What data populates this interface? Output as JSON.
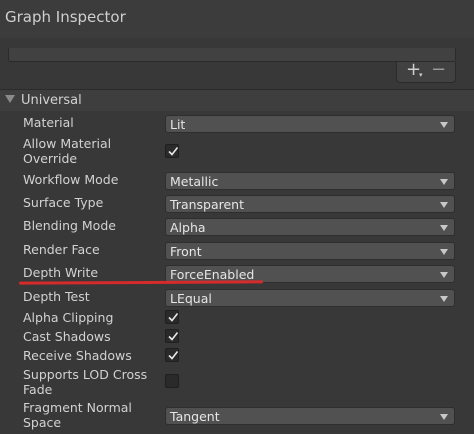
{
  "window": {
    "title": "Graph Inspector"
  },
  "list_controls": {
    "add_label": "+",
    "remove_label": "−"
  },
  "section": {
    "label": "Universal"
  },
  "properties": {
    "material": {
      "label": "Material",
      "value": "Lit"
    },
    "allow_override": {
      "label": "Allow Material Override",
      "checked": true
    },
    "workflow_mode": {
      "label": "Workflow Mode",
      "value": "Metallic"
    },
    "surface_type": {
      "label": "Surface Type",
      "value": "Transparent"
    },
    "blending_mode": {
      "label": "Blending Mode",
      "value": "Alpha"
    },
    "render_face": {
      "label": "Render Face",
      "value": "Front"
    },
    "depth_write": {
      "label": "Depth Write",
      "value": "ForceEnabled"
    },
    "depth_test": {
      "label": "Depth Test",
      "value": "LEqual"
    },
    "alpha_clipping": {
      "label": "Alpha Clipping",
      "checked": true
    },
    "cast_shadows": {
      "label": "Cast Shadows",
      "checked": true
    },
    "receive_shadows": {
      "label": "Receive Shadows",
      "checked": true
    },
    "supports_lod": {
      "label": "Supports LOD Cross Fade",
      "checked": false
    },
    "fragment_normal": {
      "label": "Fragment Normal Space",
      "value": "Tangent"
    }
  },
  "colors": {
    "annotation_underline": "#d52b2b"
  }
}
